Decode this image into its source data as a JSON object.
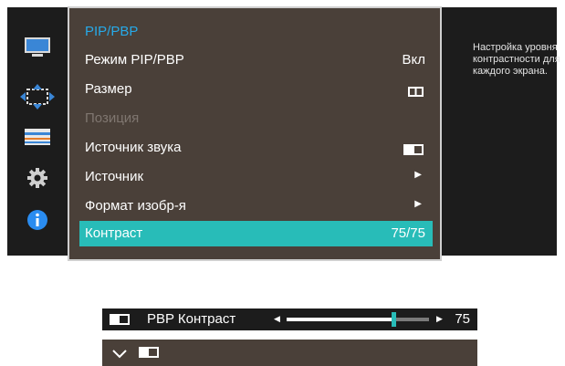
{
  "menu": {
    "title": "PIP/PBP",
    "items": [
      {
        "label": "Режим PIP/PBP",
        "value": "Вкл"
      },
      {
        "label": "Размер"
      },
      {
        "label": "Позиция"
      },
      {
        "label": "Источник звука"
      },
      {
        "label": "Источник"
      },
      {
        "label": "Формат изобр-я"
      },
      {
        "label": "Контраст",
        "value": "75/75"
      }
    ]
  },
  "help_text": "Настройка уровня контрастности для каждого экрана.",
  "sidebar_icons": [
    "monitor-icon",
    "move-arrows-icon",
    "adjust-lines-icon",
    "gear-icon",
    "info-icon"
  ],
  "pbp_contrast": {
    "label": "PBP Контраст",
    "value": "75",
    "level": 75
  },
  "colors": {
    "accent": "#27a9e8",
    "selected": "#28bcb8",
    "menu_bg": "#4a4039",
    "osd_bg": "#1c1c1c"
  }
}
